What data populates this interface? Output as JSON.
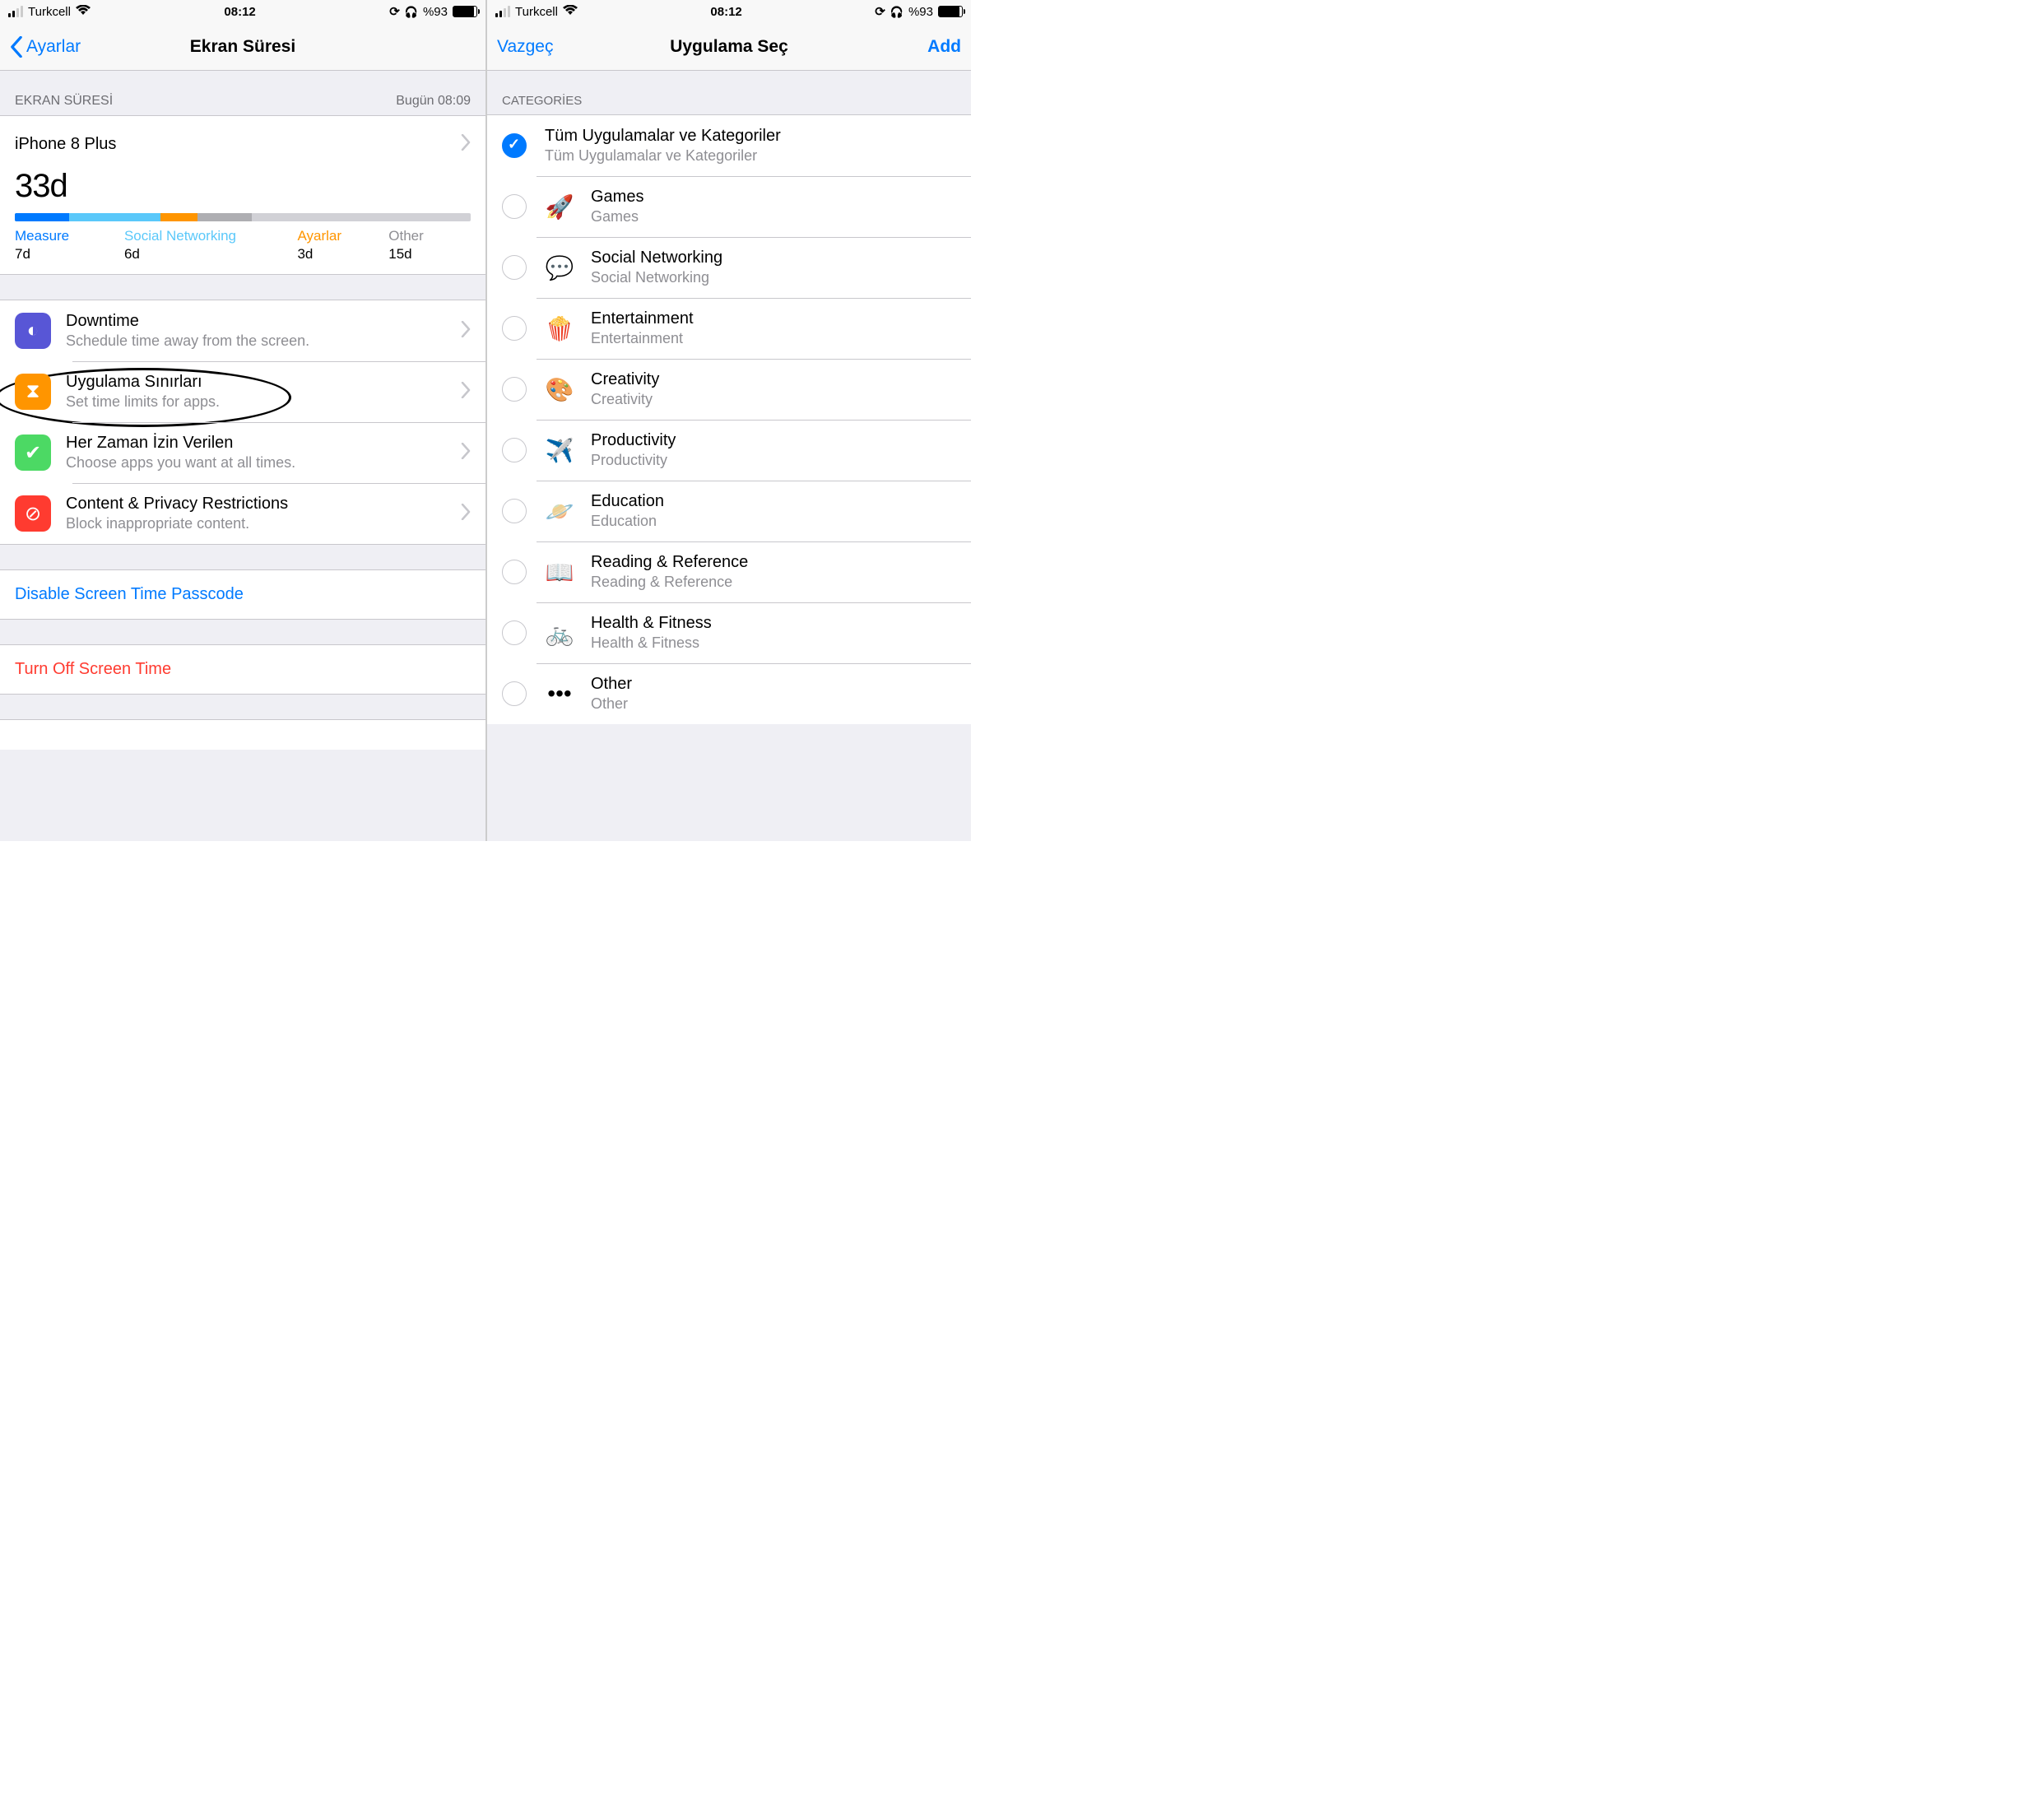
{
  "status": {
    "carrier": "Turkcell",
    "time": "08:12",
    "battery_text": "%93"
  },
  "left": {
    "nav": {
      "back": "Ayarlar",
      "title": "Ekran Süresi"
    },
    "section": {
      "header": "EKRAN SÜRESİ",
      "timestamp": "Bugün 08:09"
    },
    "device": "iPhone 8 Plus",
    "total": "33d",
    "bars": [
      {
        "color": "#007aff",
        "pct": 12
      },
      {
        "color": "#5ac8fa",
        "pct": 20
      },
      {
        "color": "#ff9500",
        "pct": 8
      },
      {
        "color": "#aeaeb2",
        "pct": 12
      }
    ],
    "cats": [
      {
        "label": "Measure",
        "value": "7d",
        "color": "#007aff",
        "width": "24%"
      },
      {
        "label": "Social Networking",
        "value": "6d",
        "color": "#5ac8fa",
        "width": "38%"
      },
      {
        "label": "Ayarlar",
        "value": "3d",
        "color": "#ff9500",
        "width": "20%"
      },
      {
        "label": "Other",
        "value": "15d",
        "color": "#8e8e93",
        "width": "18%"
      }
    ],
    "items": [
      {
        "title": "Downtime",
        "sub": "Schedule time away from the screen.",
        "bg": "#5856d6",
        "glyph": "◐"
      },
      {
        "title": "Uygulama Sınırları",
        "sub": "Set time limits for apps.",
        "bg": "#ff9500",
        "glyph": "⧗"
      },
      {
        "title": "Her Zaman İzin Verilen",
        "sub": "Choose apps you want at all times.",
        "bg": "#4cd964",
        "glyph": "✔"
      },
      {
        "title": "Content & Privacy Restrictions",
        "sub": "Block inappropriate content.",
        "bg": "#ff3b30",
        "glyph": "⊘"
      }
    ],
    "link_disable": "Disable Screen Time Passcode",
    "link_turnoff": "Turn Off Screen Time"
  },
  "right": {
    "nav": {
      "cancel": "Vazgeç",
      "title": "Uygulama Seç",
      "add": "Add"
    },
    "section_header": "CATEGORİES",
    "categories": [
      {
        "title": "Tüm Uygulamalar ve Kategoriler",
        "sub": "Tüm Uygulamalar ve Kategoriler",
        "checked": true,
        "icon": ""
      },
      {
        "title": "Games",
        "sub": "Games",
        "checked": false,
        "icon": "🚀"
      },
      {
        "title": "Social Networking",
        "sub": "Social Networking",
        "checked": false,
        "icon": "💬"
      },
      {
        "title": "Entertainment",
        "sub": "Entertainment",
        "checked": false,
        "icon": "🍿"
      },
      {
        "title": "Creativity",
        "sub": "Creativity",
        "checked": false,
        "icon": "🎨"
      },
      {
        "title": "Productivity",
        "sub": "Productivity",
        "checked": false,
        "icon": "✈️"
      },
      {
        "title": "Education",
        "sub": "Education",
        "checked": false,
        "icon": "🪐"
      },
      {
        "title": "Reading & Reference",
        "sub": "Reading & Reference",
        "checked": false,
        "icon": "📖"
      },
      {
        "title": "Health & Fitness",
        "sub": "Health & Fitness",
        "checked": false,
        "icon": "🚲"
      },
      {
        "title": "Other",
        "sub": "Other",
        "checked": false,
        "icon": "•••"
      }
    ]
  }
}
